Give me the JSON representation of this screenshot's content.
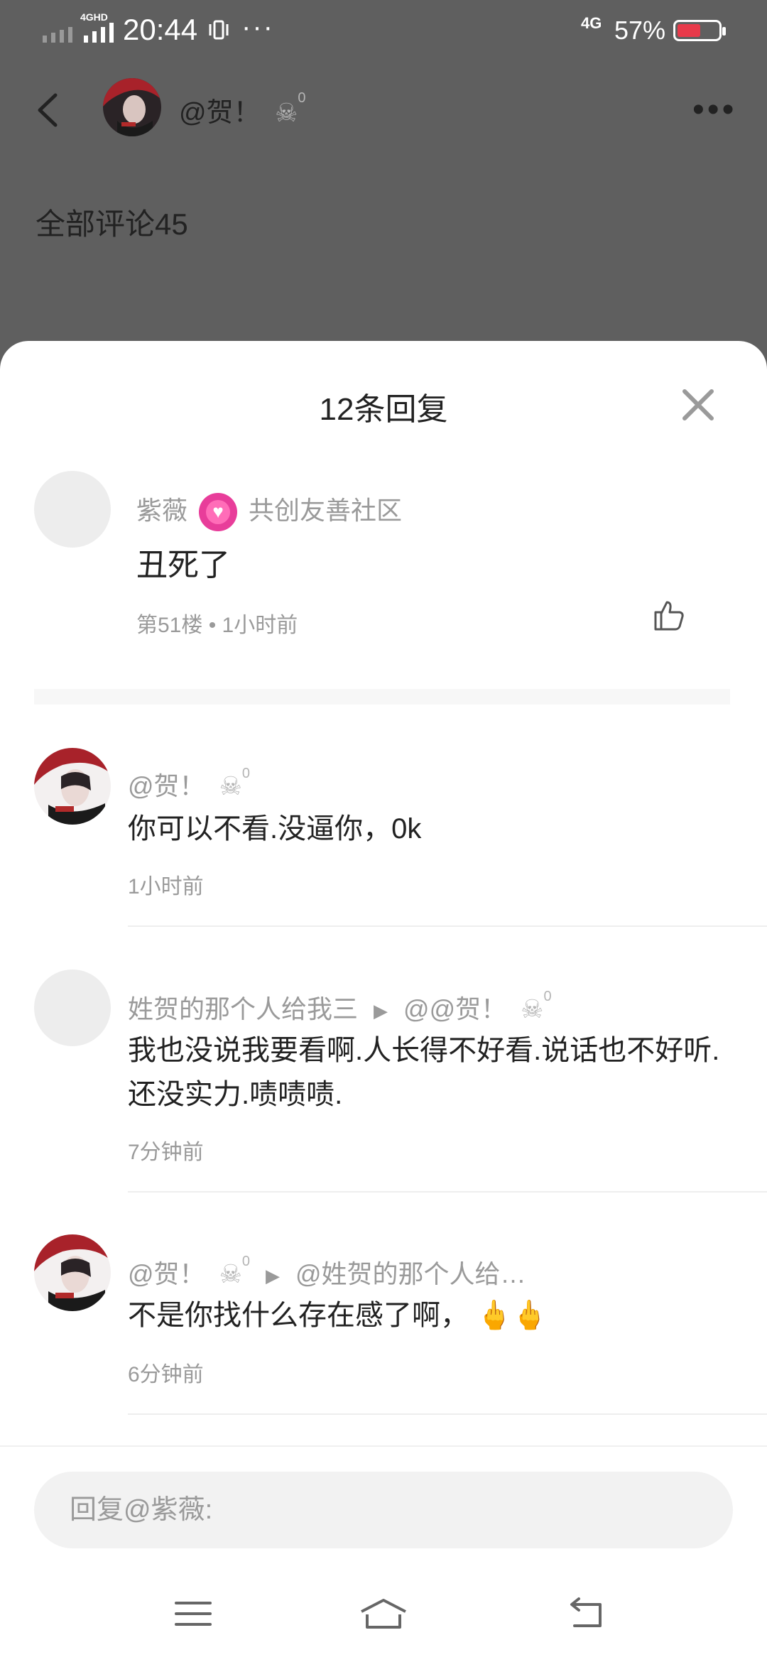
{
  "status_bar": {
    "network_label": "4GHD",
    "time": "20:44",
    "extra_dots": "···",
    "network_right": "4G",
    "battery_percent": "57%",
    "battery_level": 0.57,
    "battery_color": "#e83a4a"
  },
  "header": {
    "username": "@贺！",
    "count_sup": "0",
    "section_title": "全部评论45"
  },
  "sheet": {
    "title": "12条回复",
    "main_comment": {
      "author": "紫薇",
      "badge_label": "共创友善社区",
      "text": "丑死了",
      "meta": "第51楼 • 1小时前"
    },
    "replies": [
      {
        "author": "@贺！",
        "author_sup": "0",
        "text": "你可以不看.没逼你，0k",
        "time": "1小时前"
      },
      {
        "author": "姓贺的那个人给我三",
        "target": "@@贺！",
        "target_sup": "0",
        "text": "我也没说我要看啊.人长得不好看.说话也不好听.还没实力.啧啧啧.",
        "time": "7分钟前"
      },
      {
        "author": "@贺！",
        "author_sup": "0",
        "target": "@姓贺的那个人给…",
        "text": "不是你找什么存在感了啊，",
        "emoji": "🖕🖕",
        "time": "6分钟前"
      }
    ]
  },
  "input": {
    "placeholder": "回复@紫薇:"
  },
  "colors": {
    "accent_badge": "#e83d9a",
    "muted_text": "#9a9a9a"
  }
}
